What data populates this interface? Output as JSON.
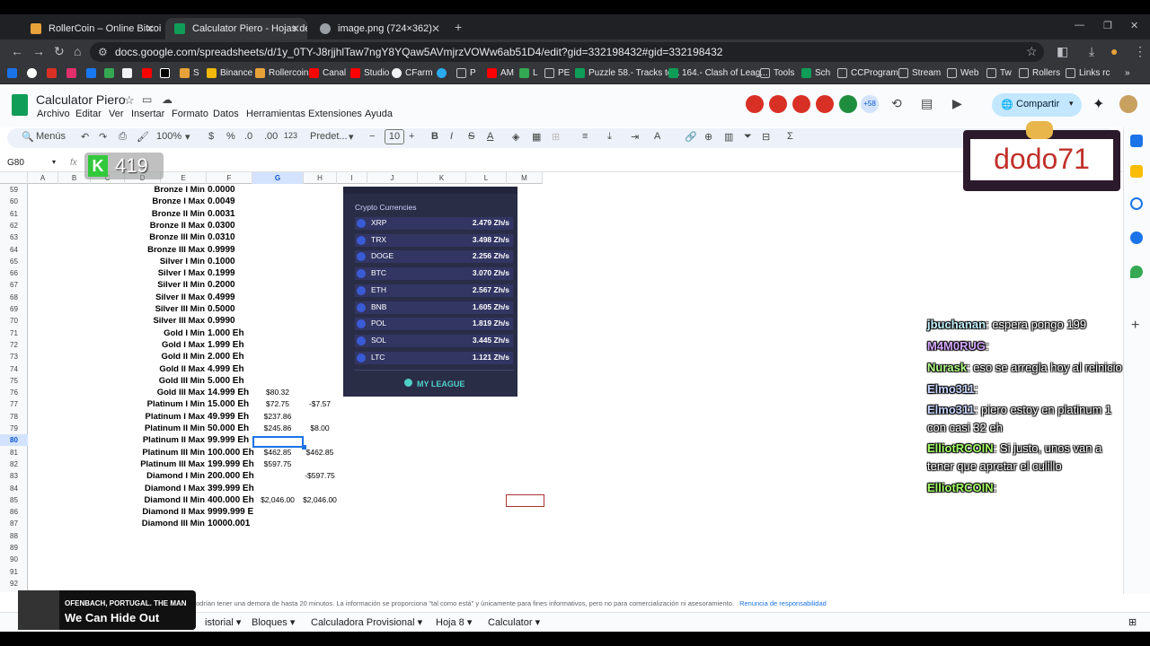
{
  "browser": {
    "tabs": [
      {
        "title": "RollerCoin – Online Bitcoin Mi"
      },
      {
        "title": "Calculator Piero - Hojas de cálc"
      },
      {
        "title": "image.png (724×362)"
      }
    ],
    "new_tab": "+",
    "url": "docs.google.com/spreadsheets/d/1y_0TY-J8rjjhlTaw7ngY8YQaw5AVmjrzVOWw6ab51D4/edit?gid=332198432#gid=332198432",
    "bookmarks": [
      "S",
      "Binance",
      "Rollercoin",
      "Canal",
      "Studio",
      "CFarm",
      "P",
      "AM",
      "L",
      "PE",
      "Puzzle 58.- Tracks to...",
      "164.- Clash of Leag...",
      "Tools",
      "Sch",
      "CCProgram",
      "Stream",
      "Web",
      "Tw",
      "Rollers",
      "Links rc"
    ]
  },
  "sheets": {
    "doc_title": "Calculator Piero",
    "menus": [
      "Archivo",
      "Editar",
      "Ver",
      "Insertar",
      "Formato",
      "Datos",
      "Herramientas",
      "Extensiones",
      "Ayuda"
    ],
    "share_label": "Compartir",
    "presence_count": "+58",
    "toolbar": {
      "search": "Menús",
      "zoom": "100%",
      "currency": "$",
      "percent": "%",
      "dec_less": ".0",
      "dec_more": ".00",
      "number_fmt": "123",
      "font": "Predet...",
      "font_size": "10",
      "bold": "B",
      "italic": "I",
      "strike": "S",
      "text_color": "A",
      "sum": "Σ"
    },
    "name_box": "G80",
    "fx": "fx",
    "columns": [
      "A",
      "B",
      "C",
      "D",
      "E",
      "F",
      "G",
      "H",
      "I",
      "J",
      "K",
      "L",
      "M"
    ],
    "rows": [
      {
        "n": "59",
        "e": "Bronze I Min",
        "f": "0.0000",
        "g": "",
        "h": ""
      },
      {
        "n": "60",
        "e": "Bronze I Max",
        "f": "0.0049",
        "g": "",
        "h": ""
      },
      {
        "n": "61",
        "e": "Bronze II Min",
        "f": "0.0031",
        "g": "",
        "h": ""
      },
      {
        "n": "62",
        "e": "Bronze II Max",
        "f": "0.0300",
        "g": "",
        "h": ""
      },
      {
        "n": "63",
        "e": "Bronze III Min",
        "f": "0.0310",
        "g": "",
        "h": ""
      },
      {
        "n": "64",
        "e": "Bronze III Max",
        "f": "0.9999",
        "g": "",
        "h": ""
      },
      {
        "n": "65",
        "e": "Silver I Min",
        "f": "0.1000",
        "g": "",
        "h": ""
      },
      {
        "n": "66",
        "e": "Silver I Max",
        "f": "0.1999",
        "g": "",
        "h": ""
      },
      {
        "n": "67",
        "e": "Silver II Min",
        "f": "0.2000",
        "g": "",
        "h": ""
      },
      {
        "n": "68",
        "e": "Silver II Max",
        "f": "0.4999",
        "g": "",
        "h": ""
      },
      {
        "n": "69",
        "e": "Silver III Min",
        "f": "0.5000",
        "g": "",
        "h": ""
      },
      {
        "n": "70",
        "e": "Silver III Max",
        "f": "0.9990",
        "g": "",
        "h": ""
      },
      {
        "n": "71",
        "e": "Gold I Min",
        "f": "1.000 Eh",
        "g": "",
        "h": ""
      },
      {
        "n": "72",
        "e": "Gold I Max",
        "f": "1.999 Eh",
        "g": "",
        "h": ""
      },
      {
        "n": "73",
        "e": "Gold II Min",
        "f": "2.000 Eh",
        "g": "",
        "h": ""
      },
      {
        "n": "74",
        "e": "Gold II Max",
        "f": "4.999 Eh",
        "g": "",
        "h": ""
      },
      {
        "n": "75",
        "e": "Gold III Min",
        "f": "5.000 Eh",
        "g": "",
        "h": ""
      },
      {
        "n": "76",
        "e": "Gold III Max",
        "f": "14.999 Eh",
        "g": "$80.32",
        "h": ""
      },
      {
        "n": "77",
        "e": "Platinum I Min",
        "f": "15.000 Eh",
        "g": "$72.75",
        "h": "-$7.57"
      },
      {
        "n": "78",
        "e": "Platinum I Max",
        "f": "49.999 Eh",
        "g": "$237.86",
        "h": ""
      },
      {
        "n": "79",
        "e": "Platinum II Min",
        "f": "50.000 Eh",
        "g": "$245.86",
        "h": "$8.00"
      },
      {
        "n": "80",
        "e": "Platinum II Max",
        "f": "99.999 Eh",
        "g": "",
        "h": ""
      },
      {
        "n": "81",
        "e": "Platinum III Min",
        "f": "100.000 Eh",
        "g": "$462.85",
        "h": "$462.85"
      },
      {
        "n": "82",
        "e": "Platinum III Max",
        "f": "199.999 Eh",
        "g": "$597.75",
        "h": ""
      },
      {
        "n": "83",
        "e": "Diamond I Min",
        "f": "200.000 Eh",
        "g": "",
        "h": "-$597.75"
      },
      {
        "n": "84",
        "e": "Diamond I Max",
        "f": "399.999 Eh",
        "g": "",
        "h": ""
      },
      {
        "n": "85",
        "e": "Diamond II Min",
        "f": "400.000 Eh",
        "g": "$2,046.00",
        "h": "$2,046.00"
      },
      {
        "n": "86",
        "e": "Diamond II Max",
        "f": "9999.999 E",
        "g": "",
        "h": ""
      },
      {
        "n": "87",
        "e": "Diamond III Min",
        "f": "10000.001",
        "g": "",
        "h": ""
      },
      {
        "n": "88",
        "e": "",
        "f": "",
        "g": "",
        "h": ""
      },
      {
        "n": "89",
        "e": "",
        "f": "",
        "g": "",
        "h": ""
      },
      {
        "n": "90",
        "e": "",
        "f": "",
        "g": "",
        "h": ""
      },
      {
        "n": "91",
        "e": "",
        "f": "",
        "g": "",
        "h": ""
      },
      {
        "n": "92",
        "e": "",
        "f": "",
        "g": "",
        "h": ""
      }
    ],
    "disclaimer": "odrían tener una demora de hasta 20 minutos. La información se proporciona \"tal como está\" y únicamente para fines informativos, pero no para comercialización ni asesoramiento.",
    "disclaimer_link": "Renuncia de responsabilidad",
    "sheet_tabs": [
      "istorial",
      "Bloques",
      "Calculadora Provisional",
      "Hoja 8",
      "Calculator"
    ]
  },
  "crypto_panel": {
    "title": "Crypto Currencies",
    "coins": [
      {
        "name": "XRP",
        "value": "2.479 Zh/s"
      },
      {
        "name": "TRX",
        "value": "3.498 Zh/s"
      },
      {
        "name": "DOGE",
        "value": "2.256 Zh/s"
      },
      {
        "name": "BTC",
        "value": "3.070 Zh/s"
      },
      {
        "name": "ETH",
        "value": "2.567 Zh/s"
      },
      {
        "name": "BNB",
        "value": "1.605 Zh/s"
      },
      {
        "name": "POL",
        "value": "1.819 Zh/s"
      },
      {
        "name": "SOL",
        "value": "3.445 Zh/s"
      },
      {
        "name": "LTC",
        "value": "1.121 Zh/s"
      }
    ],
    "league_button": "MY LEAGUE"
  },
  "stream": {
    "viewer_count": "419",
    "name_plate": "dodo71",
    "chat": [
      {
        "user": "jbuchanan",
        "msg": ": espera pongo 199"
      },
      {
        "user": "M4M0RUG",
        "msg": ":"
      },
      {
        "user": "Nurask",
        "msg": ": eso se arregla hoy al reinicio"
      },
      {
        "user": "Elmo311",
        "msg": ":"
      },
      {
        "user": "Elmo311",
        "msg": ": piero estoy en platinum 1"
      },
      {
        "user": "",
        "msg": "con casi 32 eh"
      },
      {
        "user": "ElliotRCOIN",
        "msg": ": Si justo, unos van a"
      },
      {
        "user": "",
        "msg": "tener que apretar el culillo"
      },
      {
        "user": "ElliotRCOIN",
        "msg": ":"
      }
    ],
    "now_playing_artist": "OFENBACH, PORTUGAL. THE MAN",
    "now_playing_song": "We Can Hide Out"
  },
  "colors": {
    "sheets_green": "#0f9d58",
    "accent_blue": "#1a73e8",
    "panel_bg": "#2a2d46"
  }
}
